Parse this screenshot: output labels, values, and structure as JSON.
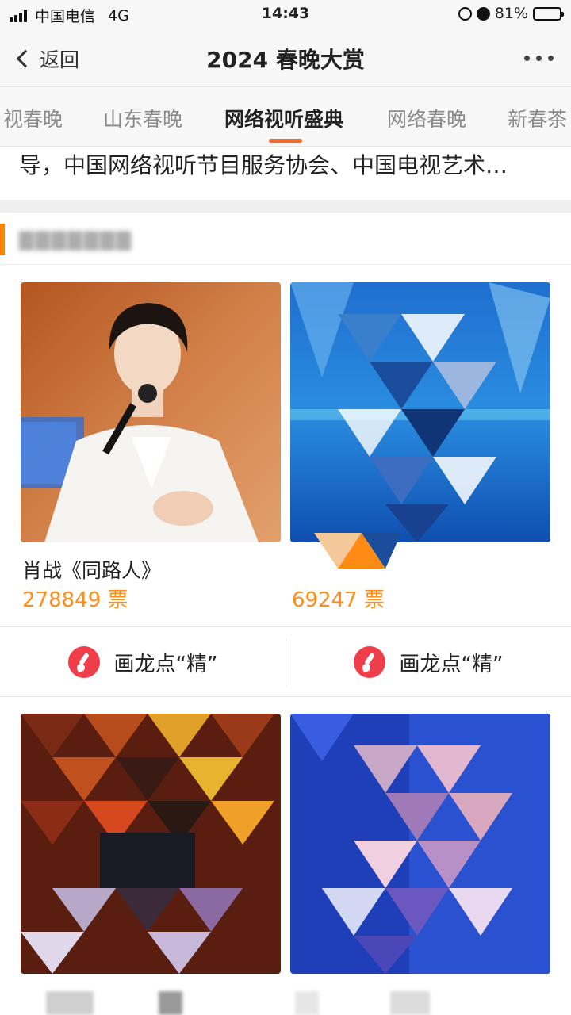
{
  "status_bar": {
    "carrier": "中国电信",
    "network": "4G",
    "time": "14:43",
    "battery": "81%",
    "icons": [
      "signal-icon",
      "rotation-lock-icon",
      "alarm-icon",
      "battery-icon"
    ]
  },
  "nav": {
    "back_label": "返回",
    "title": "2024 春晚大赏",
    "more_icon": "more-dots-icon"
  },
  "tabs": [
    {
      "label": "视春晚"
    },
    {
      "label": "山东春晚"
    },
    {
      "label": "网络视听盛典",
      "active": true
    },
    {
      "label": "网络春晚"
    },
    {
      "label": "新春茶"
    }
  ],
  "intro_text": "导，中国网络视听节目服务协会、中国电视艺术…",
  "section": {
    "accent_color": "#ff8200"
  },
  "cards_row1": [
    {
      "name": "肖战《同路人》",
      "votes": "278849 票"
    },
    {
      "name": "",
      "votes": "69247 票"
    }
  ],
  "vote_buttons": [
    {
      "label": "画龙点“精”"
    },
    {
      "label": "画龙点“精”"
    }
  ],
  "colors": {
    "accent_orange": "#ff8d1a",
    "tab_underline": "#ef6a30",
    "brush_red": "#ef3e4a"
  }
}
